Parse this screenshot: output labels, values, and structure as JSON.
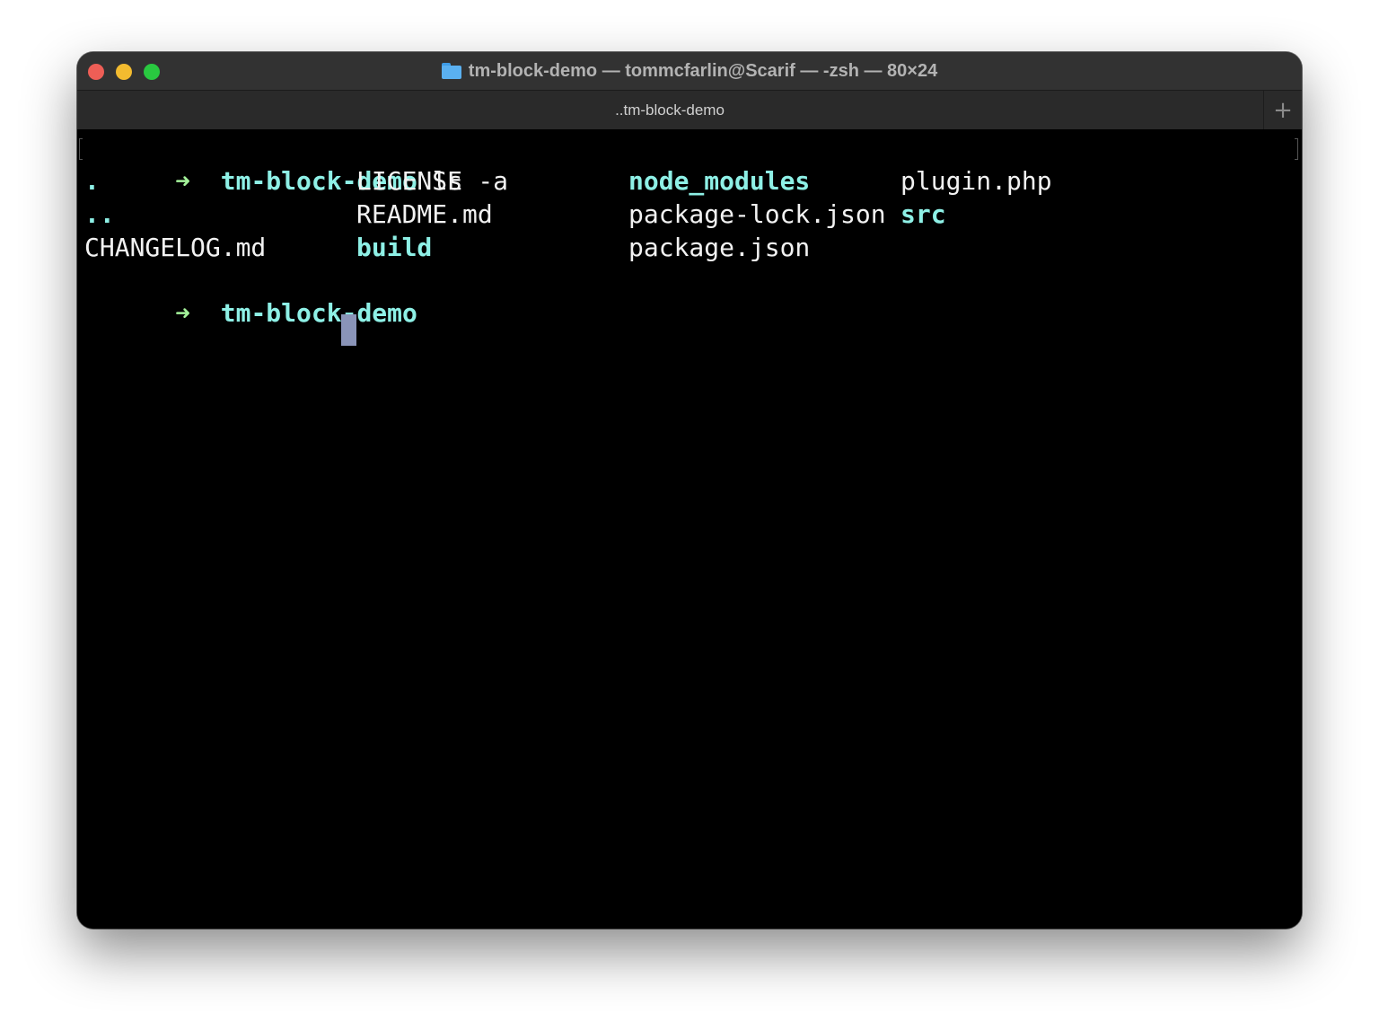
{
  "window": {
    "title": "tm-block-demo — tommcfarlin@Scarif — -zsh — 80×24",
    "tab_label": "..tm-block-demo",
    "new_tab_label": "+"
  },
  "terminal": {
    "prompt_arrow": "➜",
    "prompt_dir": "tm-block-demo",
    "command": " ls -a",
    "listing": [
      [
        ".",
        "LICENSE",
        "node_modules",
        "plugin.php"
      ],
      [
        "..",
        "README.md",
        "package-lock.json",
        "src"
      ],
      [
        "CHANGELOG.md",
        "build",
        "package.json",
        ""
      ]
    ],
    "directories": [
      ".",
      "..",
      "node_modules",
      "build",
      "src"
    ]
  },
  "colors": {
    "prompt_arrow": "#a4f29a",
    "directory": "#8ef0e6",
    "text": "#f2f2f2",
    "cursor": "#8a94b8"
  },
  "icons": {
    "title_icon": "folder-icon"
  }
}
